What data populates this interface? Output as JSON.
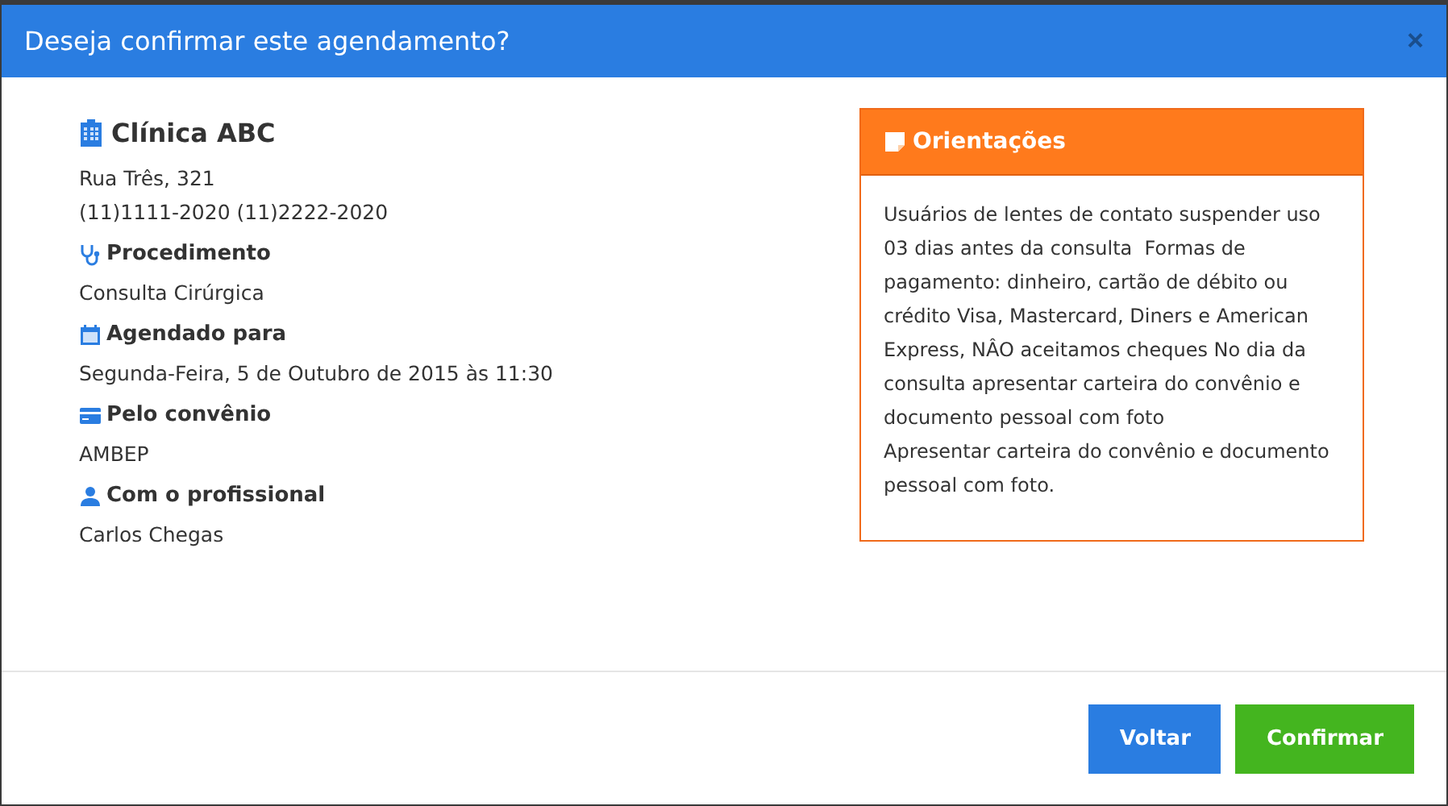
{
  "dialog": {
    "title": "Deseja confirmar este agendamento?",
    "close": "×"
  },
  "clinic": {
    "name": "Clínica ABC",
    "address": "Rua Três, 321",
    "phones": "(11)1111-2020 (11)2222-2020"
  },
  "sections": [
    {
      "kind": "procedure",
      "label": "Procedimento",
      "value": "Consulta Cirúrgica"
    },
    {
      "kind": "schedule",
      "label": "Agendado para",
      "value": "Segunda-Feira, 5 de Outubro de 2015 às 11:30"
    },
    {
      "kind": "insurance",
      "label": "Pelo convênio",
      "value": "AMBEP"
    },
    {
      "kind": "professional",
      "label": "Com o profissional",
      "value": "Carlos Chegas"
    }
  ],
  "notes": {
    "title": "Orientações",
    "paragraphs": [
      "Usuários de lentes de contato suspender uso 03 dias antes da consulta  Formas de pagamento: dinheiro, cartão de débito ou crédito Visa, Mastercard, Diners e American Express, NÂO aceitamos cheques No dia da consulta apresentar carteira do convênio e documento pessoal com foto",
      "Apresentar carteira do convênio e documento pessoal com foto."
    ]
  },
  "buttons": [
    {
      "kind": "secondary",
      "label": "Voltar"
    },
    {
      "kind": "primary",
      "label": "Confirmar"
    }
  ]
}
